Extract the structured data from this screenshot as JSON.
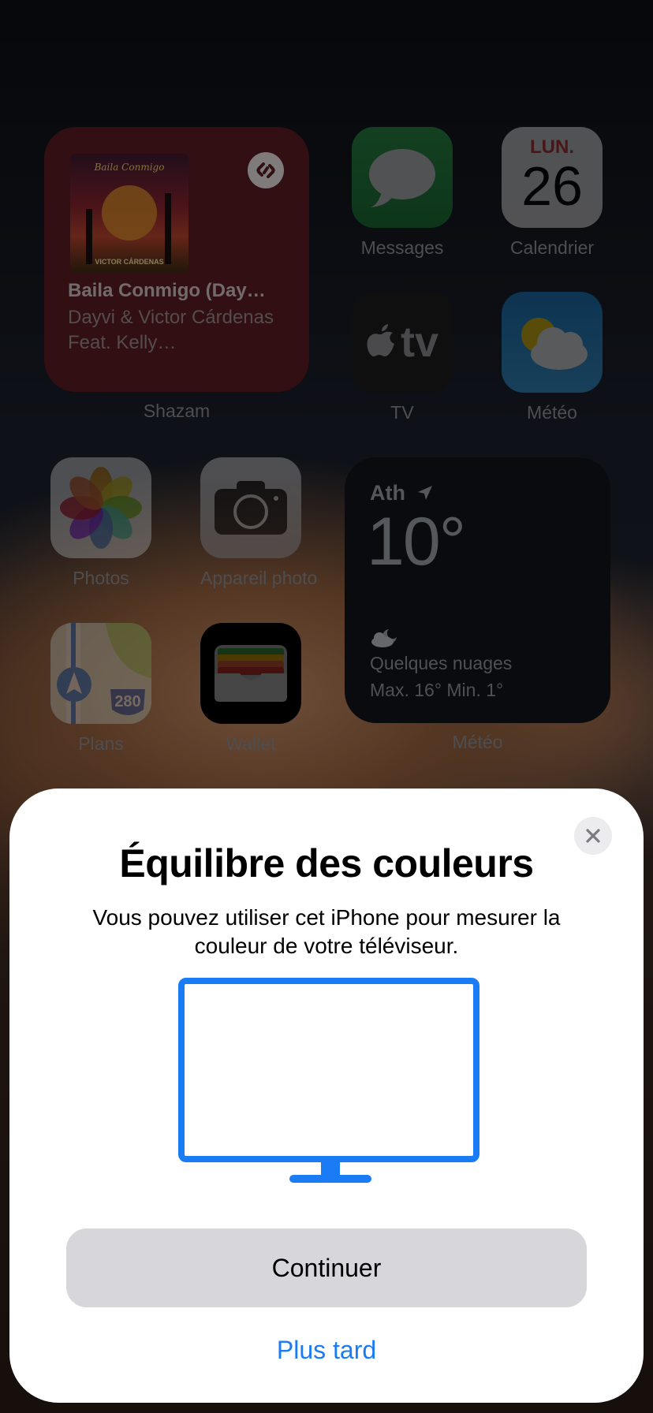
{
  "home": {
    "shazam_widget": {
      "song_title": "Baila Conmigo (Day…",
      "artist": "Dayvi & Victor Cárdenas Feat. Kelly…",
      "label": "Shazam",
      "album_art_title": "Baila Conmigo",
      "album_art_credit": "VICTOR CÁRDENAS"
    },
    "apps": [
      {
        "name": "Messages",
        "icon": "messages-icon"
      },
      {
        "name": "Calendrier",
        "icon": "calendar-icon",
        "day": "LUN.",
        "date": "26",
        "day_color": "#e5393a"
      },
      {
        "name": "TV",
        "icon": "apple-tv-icon",
        "glyph": "tv"
      },
      {
        "name": "Météo",
        "icon": "weather-icon"
      },
      {
        "name": "Photos",
        "icon": "photos-icon"
      },
      {
        "name": "Appareil photo",
        "icon": "camera-icon"
      },
      {
        "name": "Plans",
        "icon": "maps-icon",
        "route_sign": "280"
      },
      {
        "name": "Wallet",
        "icon": "wallet-icon"
      }
    ],
    "weather_widget": {
      "city": "Ath",
      "temperature": "10°",
      "condition": "Quelques nuages",
      "range": "Max. 16° Min. 1°",
      "label": "Météo"
    }
  },
  "sheet": {
    "title": "Équilibre des couleurs",
    "description": "Vous pouvez utiliser cet iPhone pour mesurer la couleur de votre téléviseur.",
    "primary_button": "Continuer",
    "secondary_button": "Plus tard",
    "accent_color": "#1a7cf5"
  }
}
